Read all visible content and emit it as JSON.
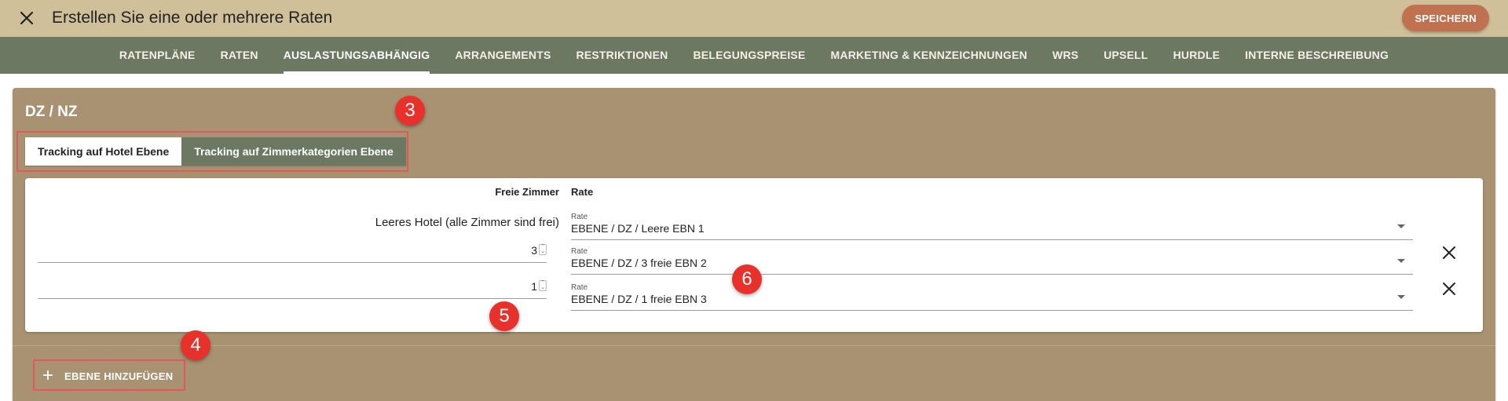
{
  "header": {
    "title": "Erstellen Sie eine oder mehrere Raten",
    "save_label": "SPEICHERN"
  },
  "nav": {
    "tabs": [
      {
        "label": "RATENPLÄNE"
      },
      {
        "label": "RATEN"
      },
      {
        "label": "AUSLASTUNGSABHÄNGIG",
        "active": true
      },
      {
        "label": "ARRANGEMENTS"
      },
      {
        "label": "RESTRIKTIONEN"
      },
      {
        "label": "BELEGUNGSPREISE"
      },
      {
        "label": "MARKETING & KENNZEICHNUNGEN"
      },
      {
        "label": "WRS"
      },
      {
        "label": "UPSELL"
      },
      {
        "label": "HURDLE"
      },
      {
        "label": "INTERNE BESCHREIBUNG"
      }
    ]
  },
  "section": {
    "title": "DZ / NZ",
    "toggle": {
      "hotel_level": "Tracking auf Hotel Ebene",
      "room_category_level": "Tracking auf Zimmerkategorien Ebene"
    }
  },
  "table": {
    "col_free_rooms": "Freie Zimmer",
    "col_rate": "Rate",
    "rows": [
      {
        "free_rooms_label": "Leeres Hotel (alle Zimmer sind frei)",
        "rate_label": "Rate",
        "rate_value": "EBENE / DZ / Leere EBN 1"
      },
      {
        "free_rooms_value": "3",
        "rate_label": "Rate",
        "rate_value": "EBENE / DZ / 3 freie EBN 2"
      },
      {
        "free_rooms_value": "1",
        "rate_label": "Rate",
        "rate_value": "EBENE / DZ / 1 freie EBN 3"
      }
    ]
  },
  "add_level_label": "EBENE HINZUFÜGEN",
  "annotations": {
    "badge_3": "3",
    "badge_4": "4",
    "badge_5": "5",
    "badge_6": "6"
  },
  "colors": {
    "topbar": "#d0c09a",
    "navbar": "#6c7861",
    "panel": "#a89272",
    "save_button": "#c0714f",
    "annotation": "#e8312b"
  }
}
